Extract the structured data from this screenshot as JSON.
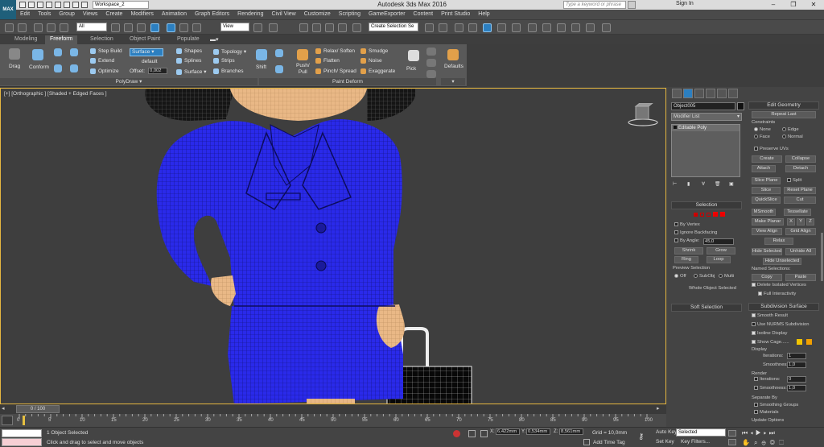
{
  "window": {
    "title": "Autodesk 3ds Max 2016",
    "workspace": "Workspace_2",
    "search_placeholder": "Type a keyword or phrase",
    "sign_in": "Sign In",
    "logo": "MAX"
  },
  "menu": [
    "Edit",
    "Tools",
    "Group",
    "Views",
    "Create",
    "Modifiers",
    "Animation",
    "Graph Editors",
    "Rendering",
    "Civil View",
    "Customize",
    "Scripting",
    "GameExporter",
    "Content",
    "Print Studio",
    "Help"
  ],
  "toolbar": {
    "selection_filter": "All",
    "ref_coord": "View",
    "named_selection": "Create Selection Se"
  },
  "ribbon": {
    "tabs": [
      "Modeling",
      "Freeform",
      "Selection",
      "Object Paint",
      "Populate"
    ],
    "active_tab": "Freeform",
    "drag": "Drag",
    "conform": "Conform",
    "step_build": "Step Build",
    "extend": "Extend",
    "optimize": "Optimize",
    "surface_btn": "Surface",
    "default": "default",
    "offset_label": "Offset:",
    "offset_value": "0,002",
    "shapes": "Shapes",
    "splines": "Splines",
    "surface": "Surface",
    "topology": "Topology",
    "strips": "Strips",
    "branches": "Branches",
    "shift": "Shift",
    "push_pull": "Push/\nPull",
    "relax_soften": "Relax/ Soften",
    "flatten": "Flatten",
    "pinch_spread": "Pinch/ Spread",
    "smudge": "Smudge",
    "noise": "Noise",
    "exaggerate": "Exaggerate",
    "pick": "Pick",
    "defaults": "Defaults",
    "group_polydraw": "PolyDraw",
    "group_paintdeform": "Paint Deform"
  },
  "viewport": {
    "label": "[+] [Orthographic ] [Shaded + Edged Faces ]",
    "mesh_color": "#2a2aea"
  },
  "command_panel": {
    "object_name": "Object005",
    "modifier_list": "Modifier List",
    "stack_item": "Editable Poly",
    "selection": {
      "title": "Selection",
      "by_vertex": "By Vertex",
      "ignore_backfacing": "Ignore Backfacing",
      "by_angle": "By Angle:",
      "angle_value": "45,0",
      "shrink": "Shrink",
      "grow": "Grow",
      "ring": "Ring",
      "loop": "Loop",
      "preview_selection": "Preview Selection",
      "preview_options": [
        "Off",
        "SubObj",
        "Multi"
      ],
      "status": "Whole Object Selected"
    },
    "soft_selection": "Soft Selection",
    "edit_geometry": {
      "title": "Edit Geometry",
      "repeat_last": "Repeat Last",
      "constraints": "Constraints",
      "constraint_options": [
        "None",
        "Edge",
        "Face",
        "Normal"
      ],
      "preserve_uvs": "Preserve UVs",
      "create": "Create",
      "collapse": "Collapse",
      "attach": "Attach",
      "detach": "Detach",
      "slice_plane": "Slice Plane",
      "split": "Split",
      "slice": "Slice",
      "reset_plane": "Reset Plane",
      "quickslice": "QuickSlice",
      "cut": "Cut",
      "msmooth": "MSmooth",
      "tessellate": "Tessellate",
      "make_planar": "Make Planar",
      "x": "X",
      "y": "Y",
      "z": "Z",
      "view_align": "View Align",
      "grid_align": "Grid Align",
      "relax": "Relax",
      "hide_selected": "Hide Selected",
      "unhide_all": "Unhide All",
      "hide_unselected": "Hide Unselected",
      "named_selections": "Named Selections:",
      "copy": "Copy",
      "paste": "Paste",
      "delete_isolated": "Delete Isolated Vertices",
      "full_interactivity": "Full Interactivity"
    },
    "subdivision": {
      "title": "Subdivision Surface",
      "smooth_result": "Smooth Result",
      "use_nurms": "Use NURMS Subdivision",
      "isoline_display": "Isoline Display",
      "show_cage": "Show Cage......",
      "display": "Display",
      "iterations_label": "Iterations:",
      "iterations_display": "1",
      "smoothness_label": "Smoothness:",
      "smoothness_display": "1,0",
      "render": "Render",
      "iterations_render": "0",
      "smoothness_render": "1,0",
      "separate_by": "Separate By",
      "smoothing_groups": "Smoothing Groups",
      "materials": "Materials",
      "update_options": "Update Options"
    }
  },
  "timeline": {
    "frame": "0 / 100",
    "ticks": [
      "0",
      "5",
      "10",
      "15",
      "20",
      "25",
      "30",
      "35",
      "40",
      "45",
      "50",
      "55",
      "60",
      "65",
      "70",
      "75",
      "80",
      "85",
      "90",
      "95",
      "100"
    ]
  },
  "status": {
    "selected": "1 Object Selected",
    "prompt": "Click and drag to select and move objects",
    "x_label": "X:",
    "x": "6,422mm",
    "y_label": "Y:",
    "y": "0,534mm",
    "z_label": "Z:",
    "z": "8,561mm",
    "grid": "Grid = 10,0mm",
    "add_time_tag": "Add Time Tag",
    "auto_key": "Auto Key",
    "set_key": "Set Key",
    "key_mode": "Selected",
    "key_filters": "Key Filters..."
  }
}
